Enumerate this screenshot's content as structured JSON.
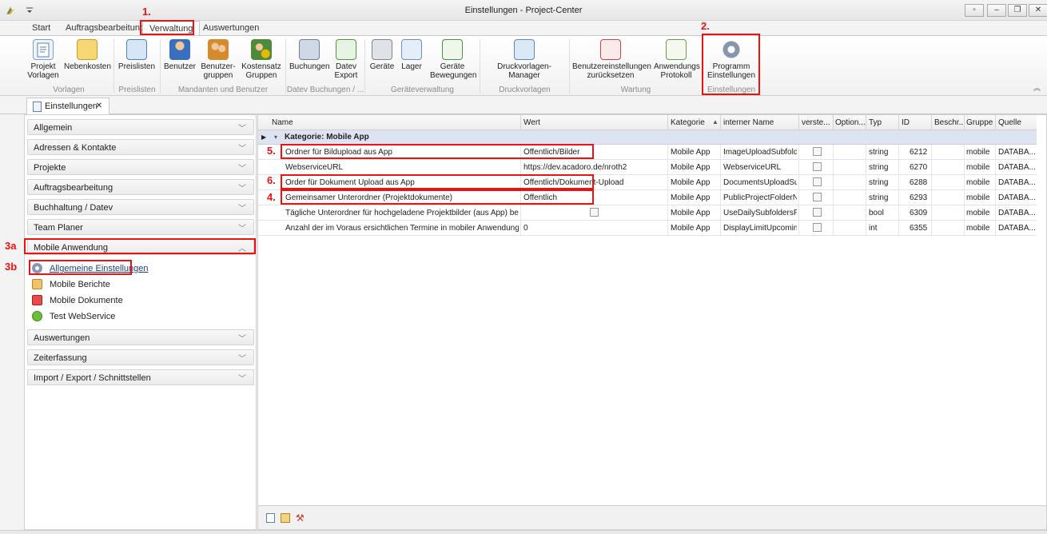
{
  "window": {
    "title": "Einstellungen - Project-Center"
  },
  "ribbon_tabs": [
    "Start",
    "Auftragsbearbeitung",
    "Verwaltung",
    "Auswertungen"
  ],
  "ribbon": {
    "buttons": {
      "projekt_vorlagen": "Projekt\nVorlagen",
      "nebenkosten": "Nebenkosten",
      "preislisten": "Preislisten",
      "benutzer": "Benutzer",
      "benutzer_gruppen": "Benutzer-\ngruppen",
      "kostensatz_gruppen": "Kostensatz\nGruppen",
      "buchungen": "Buchungen",
      "datev_export": "Datev\nExport",
      "geraete": "Geräte",
      "lager": "Lager",
      "geraete_bewegungen": "Geräte\nBewegungen",
      "druckvorlagen_manager": "Druckvorlagen-Manager",
      "benutzereinstellungen_reset": "Benutzereinstellungen\nzurücksetzen",
      "anwendungs_protokoll": "Anwendungs\nProtokoll",
      "programm_einstellungen": "Programm\nEinstellungen"
    },
    "groups": {
      "vorlagen": "Vorlagen",
      "preislisten": "Preislisten",
      "mandanten": "Mandanten und Benutzer",
      "datev": "Datev Buchungen / ...",
      "geraete": "Geräteverwaltung",
      "druck": "Druckvorlagen",
      "wartung": "Wartung",
      "einstellungen": "Einstellungen"
    }
  },
  "doc_tab": {
    "label": "Einstellungen",
    "close": "✕"
  },
  "left_panel": {
    "sections_top": [
      "Allgemein",
      "Adressen & Kontakte",
      "Projekte",
      "Auftragsbearbeitung",
      "Buchhaltung / Datev",
      "Team Planer"
    ],
    "mobile_section": "Mobile Anwendung",
    "mobile_items": [
      "Allgemeine Einstellungen",
      "Mobile Berichte",
      "Mobile Dokumente",
      "Test WebService"
    ],
    "sections_bottom": [
      "Auswertungen",
      "Zeiterfassung",
      "Import / Export / Schnittstellen"
    ]
  },
  "grid": {
    "columns": [
      "Name",
      "Wert",
      "Kategorie",
      "interner Name",
      "verste...",
      "Option...",
      "Typ",
      "ID",
      "Beschr...",
      "Gruppe",
      "Quelle"
    ],
    "group_row": "Kategorie: Mobile App",
    "rows": [
      {
        "name": "Ordner für Bildupload aus App",
        "wert": "Öffentlich/Bilder",
        "kategorie": "Mobile App",
        "intern": "ImageUploadSubfold...",
        "typ": "string",
        "id": "6212",
        "gruppe": "mobile",
        "quelle": "DATABA..."
      },
      {
        "name": "WebserviceURL",
        "wert": "https://dev.acadoro.de/nroth2",
        "kategorie": "Mobile App",
        "intern": "WebserviceURL",
        "typ": "string",
        "id": "6270",
        "gruppe": "mobile",
        "quelle": "DATABA..."
      },
      {
        "name": "Order für Dokument Upload aus App",
        "wert": "Öffentlich/Dokument-Upload",
        "kategorie": "Mobile App",
        "intern": "DocumentsUploadSu...",
        "typ": "string",
        "id": "6288",
        "gruppe": "mobile",
        "quelle": "DATABA..."
      },
      {
        "name": "Gemeinsamer Unterordner (Projektdokumente)",
        "wert": "Öffentlich",
        "kategorie": "Mobile App",
        "intern": "PublicProjectFolderN...",
        "typ": "string",
        "id": "6293",
        "gruppe": "mobile",
        "quelle": "DATABA..."
      },
      {
        "name": "Tägliche Unterordner für hochgeladene Projektbilder (aus App) benutzen",
        "wert": "",
        "kategorie": "Mobile App",
        "intern": "UseDailySubfoldersF...",
        "typ": "bool",
        "id": "6309",
        "gruppe": "mobile",
        "quelle": "DATABA..."
      },
      {
        "name": "Anzahl der im Voraus ersichtlichen Termine in mobiler Anwendung",
        "wert": "0",
        "kategorie": "Mobile App",
        "intern": "DisplayLimitUpcoming...",
        "typ": "int",
        "id": "6355",
        "gruppe": "mobile",
        "quelle": "DATABA..."
      }
    ]
  },
  "annotations": [
    "1.",
    "2.",
    "3a",
    "3b",
    "4.",
    "5.",
    "6."
  ],
  "colors": {
    "annotation": "#e11111",
    "group_row": "#dde3f1"
  }
}
